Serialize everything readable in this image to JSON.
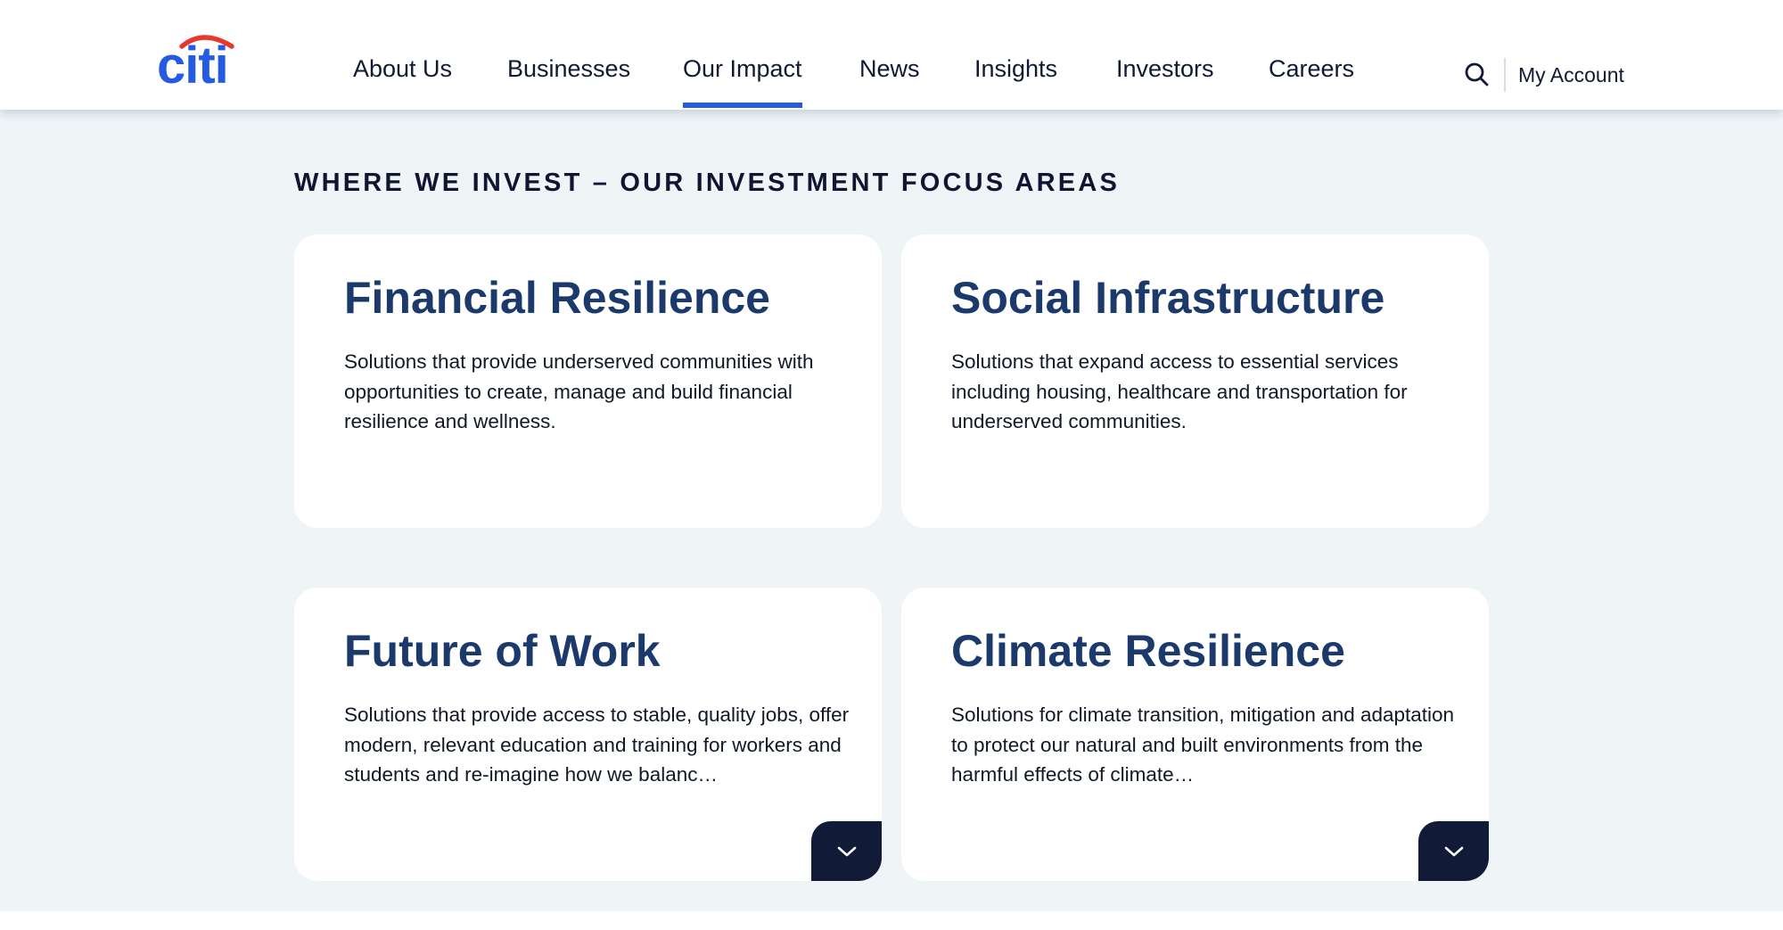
{
  "brand": {
    "logo_text": "citi",
    "logo_color": "#255be3",
    "logo_arc_color": "#e8372c"
  },
  "nav": {
    "items": [
      {
        "label": "About Us"
      },
      {
        "label": "Businesses"
      },
      {
        "label": "Our Impact",
        "active": true
      },
      {
        "label": "News"
      },
      {
        "label": "Insights"
      },
      {
        "label": "Investors"
      },
      {
        "label": "Careers"
      }
    ],
    "search_icon": "search-icon",
    "account_label": "My Account",
    "active_color": "#255be3"
  },
  "section": {
    "title": "WHERE WE INVEST – OUR INVESTMENT FOCUS AREAS",
    "background": "#eff4f7",
    "cards": [
      {
        "title": "Financial Resilience",
        "description": "Solutions that provide underserved communities with opportunities to create, manage and build financial resilience and wellness.",
        "expandable": false
      },
      {
        "title": "Social Infrastructure",
        "description": "Solutions that expand access to essential services including housing, healthcare and transportation for underserved communities.",
        "expandable": false
      },
      {
        "title": "Future of Work",
        "description": "Solutions that provide access to stable, quality jobs, offer modern, relevant education and training for workers and students and re-imagine how we balanc…",
        "expandable": true,
        "expand_icon": "chevron-down-icon"
      },
      {
        "title": "Climate Resilience",
        "description": "Solutions for climate transition, mitigation and adaptation to protect our natural and built environments from the harmful effects of climate…",
        "expandable": true,
        "expand_icon": "chevron-down-icon"
      }
    ]
  }
}
